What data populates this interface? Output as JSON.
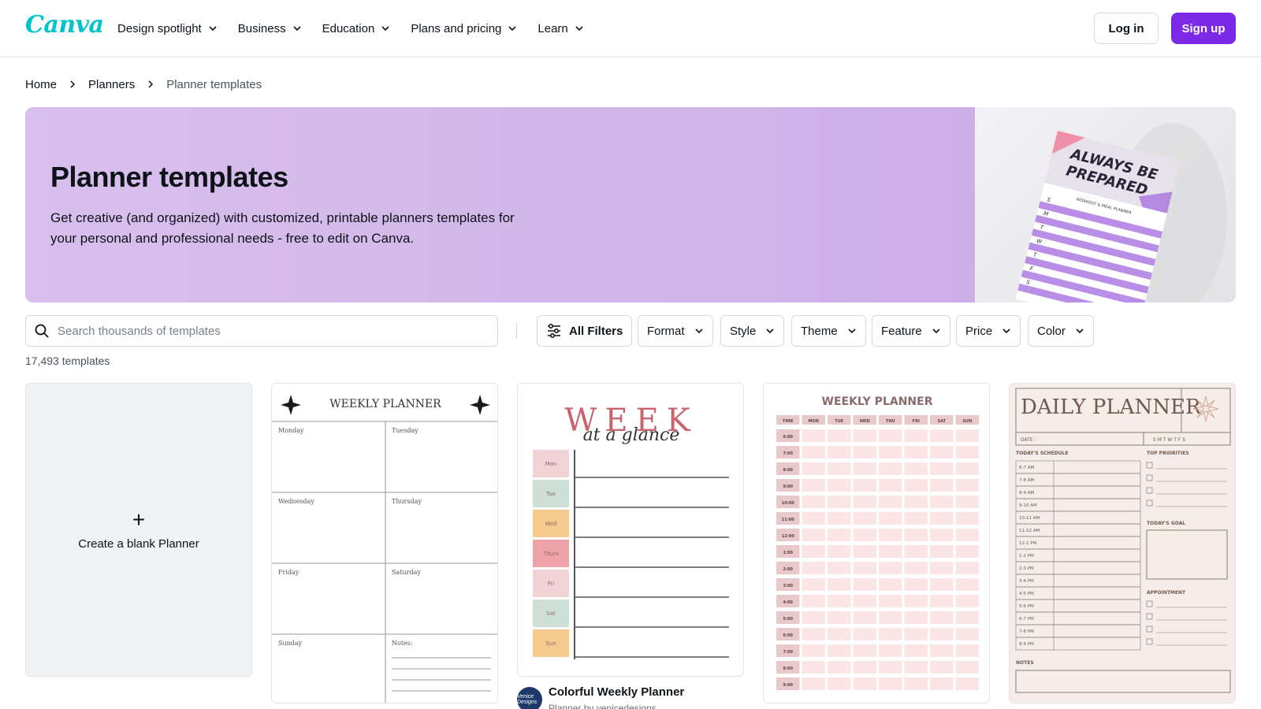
{
  "header": {
    "logo": "Canva",
    "nav": [
      "Design spotlight",
      "Business",
      "Education",
      "Plans and pricing",
      "Learn"
    ],
    "login": "Log in",
    "signup": "Sign up"
  },
  "breadcrumb": [
    "Home",
    "Planners",
    "Planner templates"
  ],
  "hero": {
    "title": "Planner templates",
    "description": "Get creative (and organized) with customized, printable planners templates for your personal and professional needs - free to edit on Canva.",
    "image_text": {
      "headline": "ALWAYS BE PREPARED",
      "subtitle": "WORKOUT & MEAL PLANNER",
      "days": [
        "S",
        "M",
        "T",
        "W",
        "T",
        "F",
        "S"
      ]
    }
  },
  "search": {
    "placeholder": "Search thousands of templates"
  },
  "filters": [
    "All Filters",
    "Format",
    "Style",
    "Theme",
    "Feature",
    "Price",
    "Color"
  ],
  "count": "17,493 templates",
  "blank_card": {
    "label": "Create a blank Planner"
  },
  "templates": [
    {
      "title": "WEEKLY PLANNER",
      "cells": [
        "Monday",
        "Tuesday",
        "Wednesday",
        "Thursday",
        "Friday",
        "Saturday",
        "Sunday",
        "Notes:"
      ]
    },
    {
      "title": "WEEK",
      "script": "at a glance",
      "days": [
        "Mon",
        "Tue",
        "Wed",
        "Thurs",
        "Fri",
        "Sat",
        "Sun"
      ],
      "caption_title": "Colorful Weekly Planner",
      "caption_sub": "Planner by venicedesigns",
      "avatar_text": "Venice Designs"
    },
    {
      "title": "WEEKLY PLANNER",
      "headers": [
        "TIME",
        "MON",
        "TUE",
        "WED",
        "THU",
        "FRI",
        "SAT",
        "SUN"
      ],
      "times": [
        "6:00",
        "7:00",
        "8:00",
        "9:00",
        "10:00",
        "11:00",
        "12:00",
        "1:00",
        "2:00",
        "3:00",
        "4:00",
        "5:00",
        "6:00",
        "7:00",
        "8:00",
        "9:00"
      ]
    },
    {
      "title": "DAILY PLANNER",
      "date_label": "DATE :",
      "weekdays": "S M T W T F S",
      "schedule_label": "TODAY'S SCHEDULE",
      "priorities_label": "TOP PRIORITIES",
      "goal_label": "TODAY'S GOAL",
      "appointment_label": "APPOINTMENT",
      "notes_label": "NOTES",
      "times": [
        "6-7 AM",
        "7-8 AM",
        "8-9 AM",
        "9-10 AM",
        "10-11 AM",
        "11-12 AM",
        "12-1 PM",
        "1-2 PM",
        "2-3 PM",
        "3-4 PM",
        "4-5 PM",
        "5-6 PM",
        "6-7 PM",
        "7-8 PM",
        "8-9 PM"
      ]
    }
  ],
  "colors": {
    "brand_purple": "#7d2ae8",
    "brand_teal": "#00c4cc",
    "hero_bg": "#d3b8ea"
  }
}
